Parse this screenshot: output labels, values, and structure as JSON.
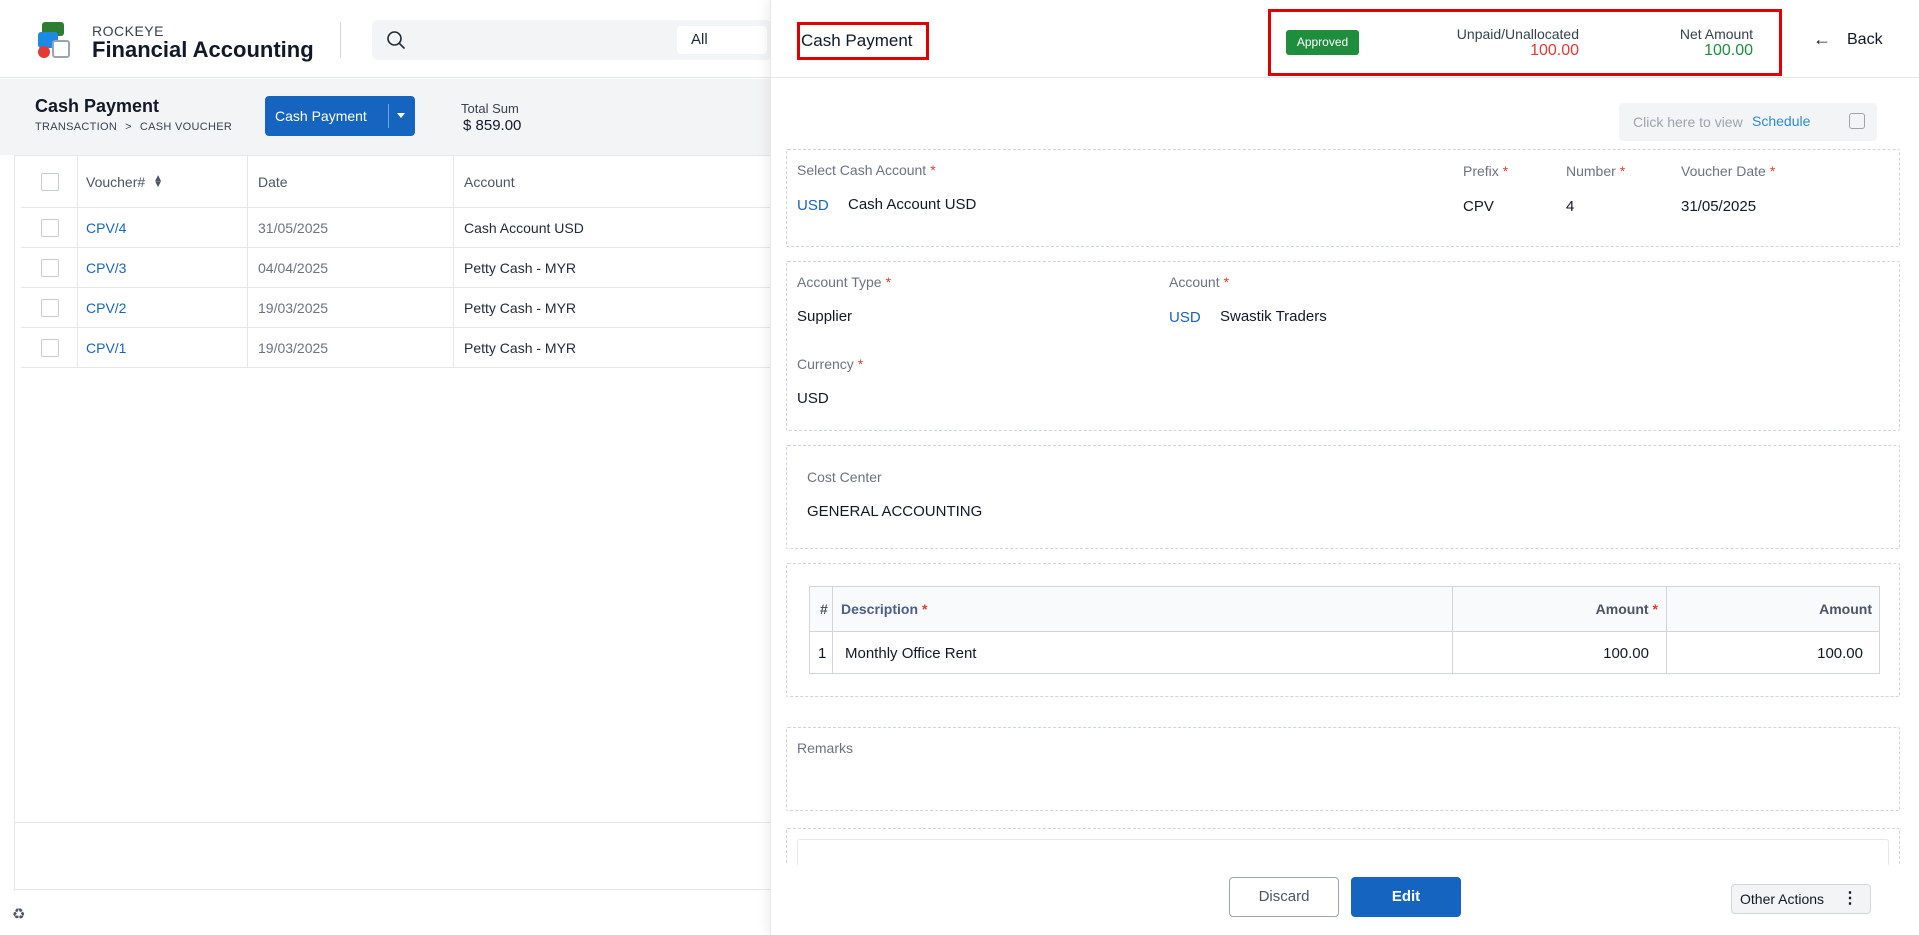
{
  "app": {
    "brand_small": "ROCKEYE",
    "brand_main": "Financial Accounting",
    "search_scope": "All",
    "logo_icon": "app-logo",
    "search_icon": "search-icon"
  },
  "page": {
    "title": "Cash Payment",
    "breadcrumb": [
      "TRANSACTION",
      ">",
      "CASH VOUCHER"
    ],
    "type_button": "Cash Payment",
    "total_label": "Total Sum",
    "total_value": "$ 859.00"
  },
  "list": {
    "columns": [
      "Voucher#",
      "Date",
      "Account"
    ],
    "rows": [
      {
        "voucher": "CPV/4",
        "date": "31/05/2025",
        "account": "Cash Account USD"
      },
      {
        "voucher": "CPV/3",
        "date": "04/04/2025",
        "account": "Petty Cash - MYR"
      },
      {
        "voucher": "CPV/2",
        "date": "19/03/2025",
        "account": "Petty Cash - MYR"
      },
      {
        "voucher": "CPV/1",
        "date": "19/03/2025",
        "account": "Petty Cash - MYR"
      }
    ]
  },
  "panel": {
    "title": "Cash Payment",
    "status": "Approved",
    "unpaid_label": "Unpaid/Unallocated",
    "unpaid_value": "100.00",
    "net_label": "Net Amount",
    "net_value": "100.00",
    "back_label": "Back",
    "schedule_hint": "Click here to view",
    "schedule_link": "Schedule",
    "fields": {
      "cash_account_label": "Select Cash Account",
      "cash_account_currency": "USD",
      "cash_account_value": "Cash Account USD",
      "prefix_label": "Prefix",
      "prefix_value": "CPV",
      "number_label": "Number",
      "number_value": "4",
      "voucher_date_label": "Voucher Date",
      "voucher_date_value": "31/05/2025",
      "account_type_label": "Account Type",
      "account_type_value": "Supplier",
      "account_label": "Account",
      "account_currency": "USD",
      "account_value": "Swastik Traders",
      "currency_label": "Currency",
      "currency_value": "USD",
      "cost_center_label": "Cost Center",
      "cost_center_value": "GENERAL ACCOUNTING",
      "remarks_label": "Remarks"
    },
    "lines": {
      "columns": [
        "#",
        "Description",
        "Amount",
        "Amount"
      ],
      "rows": [
        {
          "no": "1",
          "description": "Monthly Office Rent",
          "amount": "100.00",
          "amount2": "100.00"
        }
      ]
    },
    "footer": {
      "discard": "Discard",
      "edit": "Edit",
      "other_actions": "Other Actions"
    }
  },
  "colors": {
    "primary": "#1565c0",
    "approved": "#1e8e3e",
    "unpaid": "#e53935",
    "net": "#1e8e3e",
    "highlight": "#e00000"
  }
}
